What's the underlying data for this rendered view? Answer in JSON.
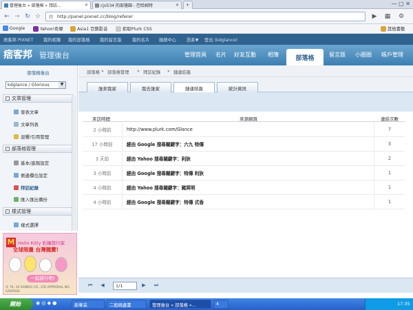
{
  "browser": {
    "tabs": [
      {
        "label": "管理後台 » 部落格 » 拜訪..."
      },
      {
        "label": "cjo534 的部落園 - 巴哈姆特"
      }
    ],
    "url": "http://panel.pixnet.cc/blog/referer",
    "bookmarks": [
      "Google",
      "Yahoo!奇摩",
      "Asia1 亞藝影音",
      "抓取Plurk CSS"
    ],
    "other_bookmarks": "其他書籤"
  },
  "topnav": [
    "痞客邦 PIXNET",
    "我的相簿",
    "我的部落格",
    "我的留言版",
    "我的名片",
    "服務中心",
    "語系▼",
    "登出 (kdglance)"
  ],
  "header": {
    "logo": "痞客邦",
    "subtitle": "管理後台",
    "menu": [
      "管理首頁",
      "名片",
      "好友互動",
      "相簿",
      "部落格",
      "留言版",
      "小圈圈",
      "帳戶管理"
    ],
    "active": "部落格"
  },
  "sidebar": {
    "heading": "部落格後台",
    "blog_select": "kdglance / Glorious",
    "sections": [
      {
        "title": "文章管理",
        "items": [
          "發表文章",
          "文章列表",
          "迴響/引用管理"
        ]
      },
      {
        "title": "部落格管理",
        "items": [
          "基本/進階設定",
          "側邊欄位設定",
          "拜訪紀錄",
          "匯入匯出備份"
        ]
      },
      {
        "title": "樣式管理",
        "items": [
          "樣式選擇"
        ]
      }
    ],
    "ad": {
      "title": "Hello Kitty 彩繪旅行家",
      "line2": "全球限量 台灣獨賣!",
      "button": "一起旅行吧!",
      "footer": "© 76, 10 SANRIO CO., LTD APPROVAL NO. G500926"
    }
  },
  "breadcrumb": [
    "部落格",
    "部落格管理",
    "拜訪紀錄",
    "鏈連結轰"
  ],
  "tabs": [
    "誰來我家",
    "我去誰家",
    "鏈連結轰",
    "統計資訊"
  ],
  "active_tab": "鏈連結轰",
  "table": {
    "headers": [
      "來訪時間",
      "來源網頁",
      "連結次數"
    ],
    "rows": [
      {
        "time": "2 小時前",
        "source": "http://www.plurk.com/Glance",
        "count": "7",
        "bold": false
      },
      {
        "time": "17 小時前",
        "source": "經由 Google 搜尋關鍵字：六九 特傳",
        "count": "3",
        "bold": true
      },
      {
        "time": "3 天前",
        "source": "經由 Yahoo 搜尋關鍵字：利狄",
        "count": "2",
        "bold": true
      },
      {
        "time": "3 小時前",
        "source": "經由 Google 搜尋關鍵字：特傳 利狄",
        "count": "1",
        "bold": true
      },
      {
        "time": "4 小時前",
        "source": "經由 Yahoo 搜尋關鍵字：豬冥明",
        "count": "1",
        "bold": true
      },
      {
        "time": "4 小時前",
        "source": "經由 Google 搜尋關鍵字：特傳 式香",
        "count": "1",
        "bold": true
      }
    ]
  },
  "pager": {
    "page": "1/1"
  },
  "taskbar": {
    "start": "開始",
    "tasks": [
      "新華采",
      "二般碼邊書",
      "管理後台 » 部落格 »...",
      "4"
    ],
    "clock": "17:35"
  }
}
